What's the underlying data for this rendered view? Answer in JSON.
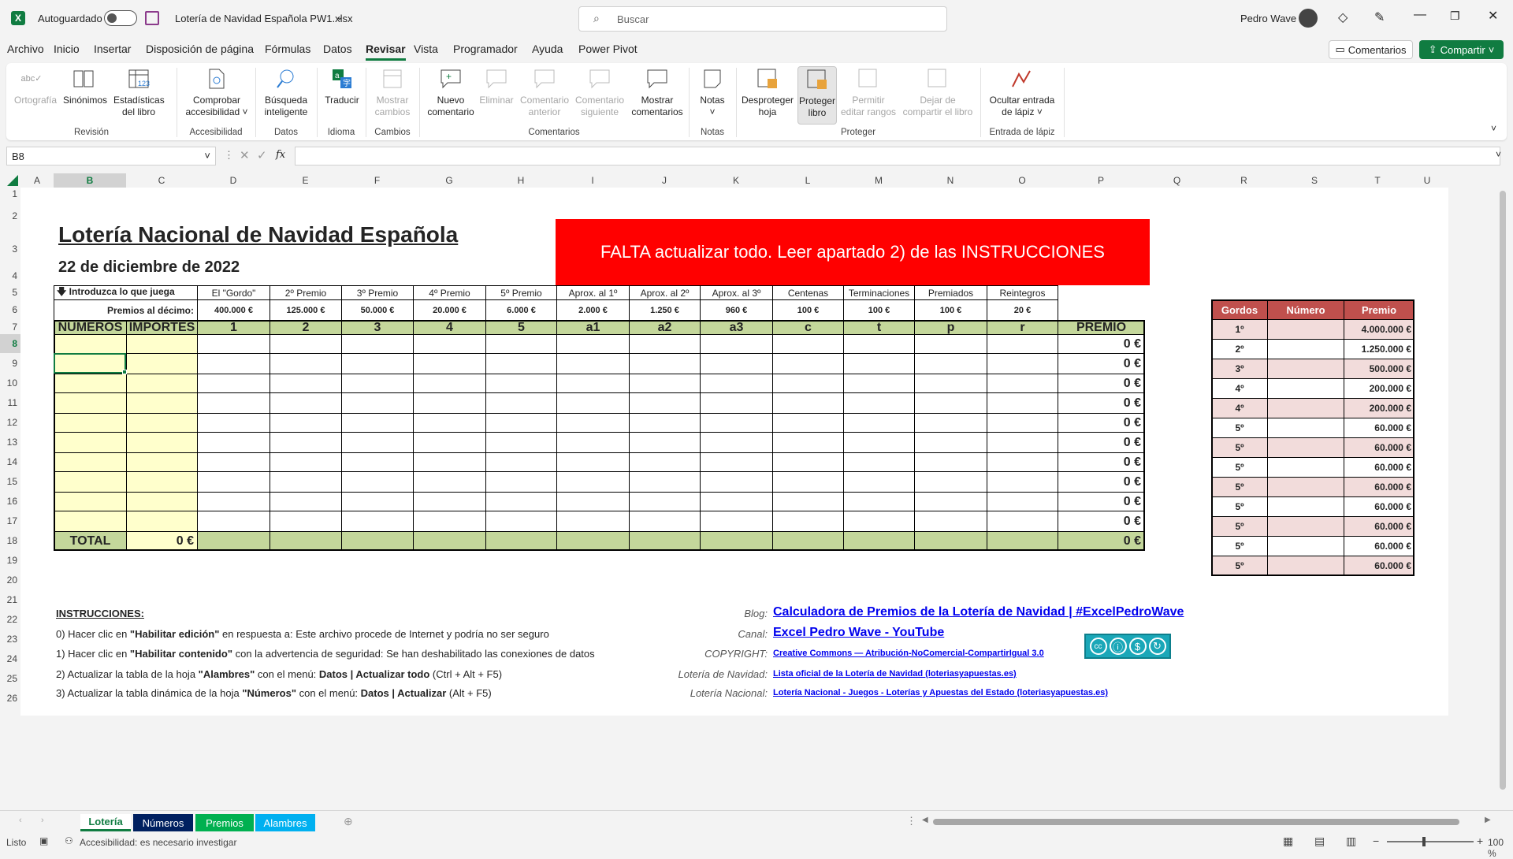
{
  "titlebar": {
    "autosave_label": "Autoguardado",
    "filename": "Lotería de Navidad Española PW1.xlsx",
    "search_placeholder": "Buscar",
    "user": "Pedro Wave"
  },
  "menu": [
    "Archivo",
    "Inicio",
    "Insertar",
    "Disposición de página",
    "Fórmulas",
    "Datos",
    "Revisar",
    "Vista",
    "Programador",
    "Ayuda",
    "Power Pivot"
  ],
  "menu_active": "Revisar",
  "buttons": {
    "comments": "Comentarios",
    "share": "Compartir"
  },
  "ribbon": {
    "ortografia": "Ortografía",
    "sinonimos": "Sinónimos",
    "estadisticas_1": "Estadísticas",
    "estadisticas_2": "del libro",
    "comprobar_1": "Comprobar",
    "comprobar_2": "accesibilidad ˅",
    "busqueda_1": "Búsqueda",
    "busqueda_2": "inteligente",
    "traducir": "Traducir",
    "mostrar_cambios_1": "Mostrar",
    "mostrar_cambios_2": "cambios",
    "nuevo_1": "Nuevo",
    "nuevo_2": "comentario",
    "eliminar": "Eliminar",
    "anterior_1": "Comentario",
    "anterior_2": "anterior",
    "siguiente_1": "Comentario",
    "siguiente_2": "siguiente",
    "mostrar_com_1": "Mostrar",
    "mostrar_com_2": "comentarios",
    "notas": "Notas",
    "desproteger_1": "Desproteger",
    "desproteger_2": "hoja",
    "proteger_1": "Proteger",
    "proteger_2": "libro",
    "permitir_1": "Permitir",
    "permitir_2": "editar rangos",
    "dejar_1": "Dejar de",
    "dejar_2": "compartir el libro",
    "ocultar_1": "Ocultar entrada",
    "ocultar_2": "de lápiz ˅",
    "groups": {
      "revision": "Revisión",
      "accesibilidad": "Accesibilidad",
      "datos": "Datos",
      "idioma": "Idioma",
      "cambios": "Cambios",
      "comentarios": "Comentarios",
      "notas": "Notas",
      "proteger": "Proteger",
      "lapiz": "Entrada de lápiz"
    }
  },
  "formula_bar": {
    "cell_ref": "B8",
    "fx": "fx",
    "value": ""
  },
  "columns": [
    "A",
    "B",
    "C",
    "D",
    "E",
    "F",
    "G",
    "H",
    "I",
    "J",
    "K",
    "L",
    "M",
    "N",
    "O",
    "P",
    "Q",
    "R",
    "S",
    "T",
    "U"
  ],
  "rows": [
    "1",
    "2",
    "3",
    "4",
    "5",
    "6",
    "7",
    "8",
    "9",
    "10",
    "11",
    "12",
    "13",
    "14",
    "15",
    "16",
    "17",
    "18",
    "19",
    "20",
    "21",
    "22",
    "23",
    "24",
    "25",
    "26"
  ],
  "sheet": {
    "title": "Lotería Nacional de Navidad Española",
    "date": "22 de diciembre de 2022",
    "banner": "FALTA actualizar todo.  Leer apartado 2) de las INSTRUCCIONES",
    "introduzca": "🡇 Introduzca lo que juega",
    "premios_decimo": "Premios al décimo:",
    "prize_names": [
      "El \"Gordo\"",
      "2º Premio",
      "3º Premio",
      "4º Premio",
      "5º Premio",
      "Aprox. al 1º",
      "Aprox. al 2º",
      "Aprox. al 3º",
      "Centenas",
      "Terminaciones",
      "Premiados",
      "Reintegros"
    ],
    "prize_values": [
      "400.000 €",
      "125.000 €",
      "50.000 €",
      "20.000 €",
      "6.000 €",
      "2.000 €",
      "1.250 €",
      "960 €",
      "100 €",
      "100 €",
      "100 €",
      "20 €"
    ],
    "hdr_numeros": "NÚMEROS",
    "hdr_importes": "IMPORTES",
    "codes": [
      "1",
      "2",
      "3",
      "4",
      "5",
      "a1",
      "a2",
      "a3",
      "c",
      "t",
      "p",
      "r"
    ],
    "hdr_premio": "PREMIO",
    "row_premios": [
      "0 €",
      "0 €",
      "0 €",
      "0 €",
      "0 €",
      "0 €",
      "0 €",
      "0 €",
      "0 €",
      "0 €"
    ],
    "total_label": "TOTAL",
    "total_importe": "0 €",
    "total_premio": "0 €"
  },
  "gordos": {
    "headers": [
      "Gordos",
      "Número",
      "Premio"
    ],
    "rows": [
      [
        "1º",
        "4.000.000 €"
      ],
      [
        "2º",
        "1.250.000 €"
      ],
      [
        "3º",
        "500.000 €"
      ],
      [
        "4º",
        "200.000 €"
      ],
      [
        "4º",
        "200.000 €"
      ],
      [
        "5º",
        "60.000 €"
      ],
      [
        "5º",
        "60.000 €"
      ],
      [
        "5º",
        "60.000 €"
      ],
      [
        "5º",
        "60.000 €"
      ],
      [
        "5º",
        "60.000 €"
      ],
      [
        "5º",
        "60.000 €"
      ],
      [
        "5º",
        "60.000 €"
      ],
      [
        "5º",
        "60.000 €"
      ]
    ]
  },
  "instructions": {
    "title": "INSTRUCCIONES:",
    "l0a": "0)  Hacer clic en ",
    "l0b": "\"Habilitar edición\"",
    "l0c": " en respuesta a: Este archivo procede de Internet y podría no ser seguro",
    "l1a": "1)  Hacer clic en ",
    "l1b": "\"Habilitar contenido\"",
    "l1c": " con la advertencia de seguridad: Se han deshabilitado las conexiones de datos",
    "l2a": "2)  Actualizar la tabla de la hoja ",
    "l2b": "\"Alambres\"",
    "l2c": " con el menú: ",
    "l2d": "Datos | Actualizar todo",
    "l2e": " (Ctrl + Alt + F5)",
    "l3a": "3)  Actualizar la tabla dinámica de la hoja ",
    "l3b": "\"Números\"",
    "l3c": " con el menú: ",
    "l3d": "Datos | Actualizar",
    "l3e": " (Alt + F5)"
  },
  "links": {
    "blog_label": "Blog:",
    "blog": "Calculadora de Premios de la Lotería de Navidad | #ExcelPedroWave",
    "canal_label": "Canal:",
    "canal": "Excel Pedro Wave - YouTube",
    "copyright_label": "COPYRIGHT:",
    "copyright": "Creative Commons — Atribución-NoComercial-CompartirIgual 3.0",
    "loteria_label": "Lotería de Navidad:",
    "loteria": "Lista oficial de la Lotería de Navidad (loteriasyapuestas.es)",
    "nacional_label": "Lotería Nacional:",
    "nacional": "Lotería Nacional - Juegos - Loterías y Apuestas del Estado (loteriasyapuestas.es)"
  },
  "sheet_tabs": [
    {
      "label": "Lotería",
      "bg": "#ffffff",
      "color": "#107c41"
    },
    {
      "label": "Números",
      "bg": "#002060",
      "color": "#ffffff"
    },
    {
      "label": "Premios",
      "bg": "#00b050",
      "color": "#ffffff"
    },
    {
      "label": "Alambres",
      "bg": "#00b0f0",
      "color": "#ffffff"
    }
  ],
  "status": {
    "ready": "Listo",
    "accessibility": "Accesibilidad: es necesario investigar",
    "zoom": "100 %"
  },
  "colors": {
    "green_header": "#c4d79b",
    "yellow_input": "#ffffcc",
    "banner_red": "#ff0000",
    "gordos_header": "#c0504d",
    "gordos_row": "#f2dcdb",
    "excel_green": "#107c41"
  }
}
